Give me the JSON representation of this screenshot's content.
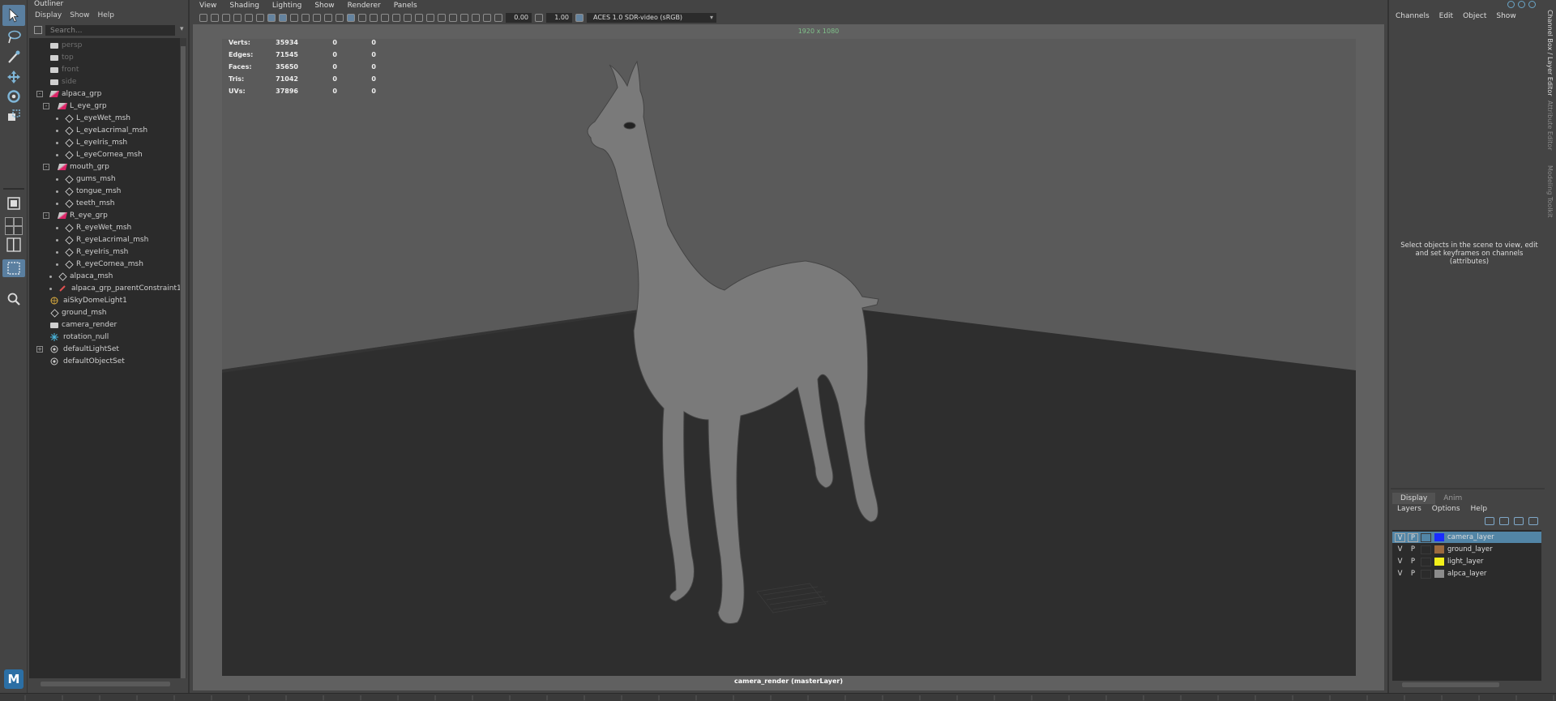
{
  "toolbox": {
    "tools": [
      "select-tool",
      "lasso-tool",
      "paint-select-tool",
      "move-tool",
      "rotate-tool",
      "scale-tool"
    ],
    "logo": "M"
  },
  "outliner": {
    "title": "Outliner",
    "menu": [
      "Display",
      "Show",
      "Help"
    ],
    "search_placeholder": "Search...",
    "items": [
      {
        "label": "persp",
        "kind": "camera",
        "depth": 0,
        "dim": true
      },
      {
        "label": "top",
        "kind": "camera",
        "depth": 0,
        "dim": true
      },
      {
        "label": "front",
        "kind": "camera",
        "depth": 0,
        "dim": true
      },
      {
        "label": "side",
        "kind": "camera",
        "depth": 0,
        "dim": true
      },
      {
        "label": "alpaca_grp",
        "kind": "group",
        "depth": 0,
        "expander": "-"
      },
      {
        "label": "L_eye_grp",
        "kind": "group",
        "depth": 1,
        "expander": "-"
      },
      {
        "label": "L_eyeWet_msh",
        "kind": "mesh",
        "depth": 2
      },
      {
        "label": "L_eyeLacrimal_msh",
        "kind": "mesh",
        "depth": 2
      },
      {
        "label": "L_eyeIris_msh",
        "kind": "mesh",
        "depth": 2
      },
      {
        "label": "L_eyeCornea_msh",
        "kind": "mesh",
        "depth": 2
      },
      {
        "label": "mouth_grp",
        "kind": "group",
        "depth": 1,
        "expander": "-"
      },
      {
        "label": "gums_msh",
        "kind": "mesh",
        "depth": 2
      },
      {
        "label": "tongue_msh",
        "kind": "mesh",
        "depth": 2
      },
      {
        "label": "teeth_msh",
        "kind": "mesh",
        "depth": 2
      },
      {
        "label": "R_eye_grp",
        "kind": "group",
        "depth": 1,
        "expander": "-"
      },
      {
        "label": "R_eyeWet_msh",
        "kind": "mesh",
        "depth": 2
      },
      {
        "label": "R_eyeLacrimal_msh",
        "kind": "mesh",
        "depth": 2
      },
      {
        "label": "R_eyeIris_msh",
        "kind": "mesh",
        "depth": 2
      },
      {
        "label": "R_eyeCornea_msh",
        "kind": "mesh",
        "depth": 2
      },
      {
        "label": "alpaca_msh",
        "kind": "mesh",
        "depth": 1
      },
      {
        "label": "alpaca_grp_parentConstraint1",
        "kind": "constraint",
        "depth": 1
      },
      {
        "label": "aiSkyDomeLight1",
        "kind": "light",
        "depth": 0
      },
      {
        "label": "ground_msh",
        "kind": "mesh",
        "depth": 0
      },
      {
        "label": "camera_render",
        "kind": "camera",
        "depth": 0
      },
      {
        "label": "rotation_null",
        "kind": "locator",
        "depth": 0
      },
      {
        "label": "defaultLightSet",
        "kind": "set",
        "depth": 0,
        "expander": "+"
      },
      {
        "label": "defaultObjectSet",
        "kind": "set",
        "depth": 0
      }
    ]
  },
  "viewport": {
    "menu": [
      "View",
      "Shading",
      "Lighting",
      "Show",
      "Renderer",
      "Panels"
    ],
    "exposure": "0.00",
    "gamma": "1.00",
    "color_space": "ACES 1.0 SDR-video (sRGB)",
    "resolution": "1920 x 1080",
    "camera_label": "camera_render (masterLayer)",
    "hud": [
      {
        "label": "Verts:",
        "a": "35934",
        "b": "0",
        "c": "0"
      },
      {
        "label": "Edges:",
        "a": "71545",
        "b": "0",
        "c": "0"
      },
      {
        "label": "Faces:",
        "a": "35650",
        "b": "0",
        "c": "0"
      },
      {
        "label": "Tris:",
        "a": "71042",
        "b": "0",
        "c": "0"
      },
      {
        "label": "UVs:",
        "a": "37896",
        "b": "0",
        "c": "0"
      }
    ],
    "colors": {
      "floor": "#2e2e2e",
      "backdrop": "#5a5a5a",
      "alpaca": "#7a7a7a",
      "res_text": "#7fc08a"
    }
  },
  "channel_box": {
    "menu": [
      "Channels",
      "Edit",
      "Object",
      "Show"
    ],
    "message": "Select objects in the scene to view, edit and set keyframes on channels (attributes)",
    "side_tabs": [
      "Channel Box / Layer Editor",
      "Attribute Editor",
      "Modeling Toolkit"
    ]
  },
  "layer_editor": {
    "tabs": [
      "Display",
      "Anim"
    ],
    "menu": [
      "Layers",
      "Options",
      "Help"
    ],
    "layers": [
      {
        "v": "V",
        "p": "P",
        "name": "camera_layer",
        "color": "#1a2cff",
        "selected": true
      },
      {
        "v": "V",
        "p": "P",
        "name": "ground_layer",
        "color": "#9c6a3e",
        "selected": false
      },
      {
        "v": "V",
        "p": "P",
        "name": "light_layer",
        "color": "#f2ef1a",
        "selected": false
      },
      {
        "v": "V",
        "p": "P",
        "name": "alpca_layer",
        "color": "#8c8c8c",
        "selected": false
      }
    ]
  }
}
